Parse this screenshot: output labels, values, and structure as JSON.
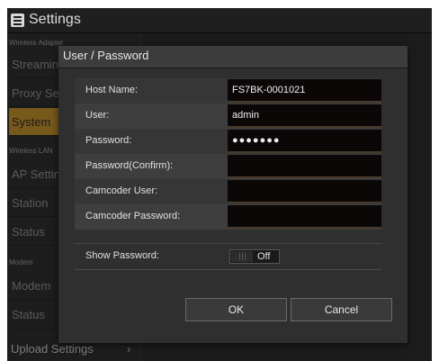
{
  "app": {
    "title": "Settings",
    "menu_icon": "hamburger-menu-icon"
  },
  "sidebar": {
    "sections": [
      {
        "label": "Wireless Adapter"
      },
      {
        "label": "Wireless LAN"
      },
      {
        "label": "Modem"
      }
    ],
    "items": [
      {
        "label": "Streaming"
      },
      {
        "label": "Proxy Server"
      },
      {
        "label": "System",
        "active": true
      },
      {
        "label": "AP Settings"
      },
      {
        "label": "Station"
      },
      {
        "label": "Status"
      },
      {
        "label": "Modem"
      },
      {
        "label": "Status"
      }
    ],
    "upload_label": "Upload Settings",
    "upload_chevron": "›"
  },
  "dialog": {
    "title": "User / Password",
    "fields": [
      {
        "label": "Host Name:",
        "value": "FS7BK-0001021"
      },
      {
        "label": "User:",
        "value": "admin"
      },
      {
        "label": "Password:",
        "value": "●●●●●●●"
      },
      {
        "label": "Password(Confirm):",
        "value": ""
      },
      {
        "label": "Camcoder User:",
        "value": ""
      },
      {
        "label": "Camcoder Password:",
        "value": ""
      }
    ],
    "show_password": {
      "label": "Show Password:",
      "state": "Off"
    },
    "ok_label": "OK",
    "cancel_label": "Cancel"
  },
  "colors": {
    "accent": "#b8892b",
    "field_bg": "#0b0707"
  }
}
